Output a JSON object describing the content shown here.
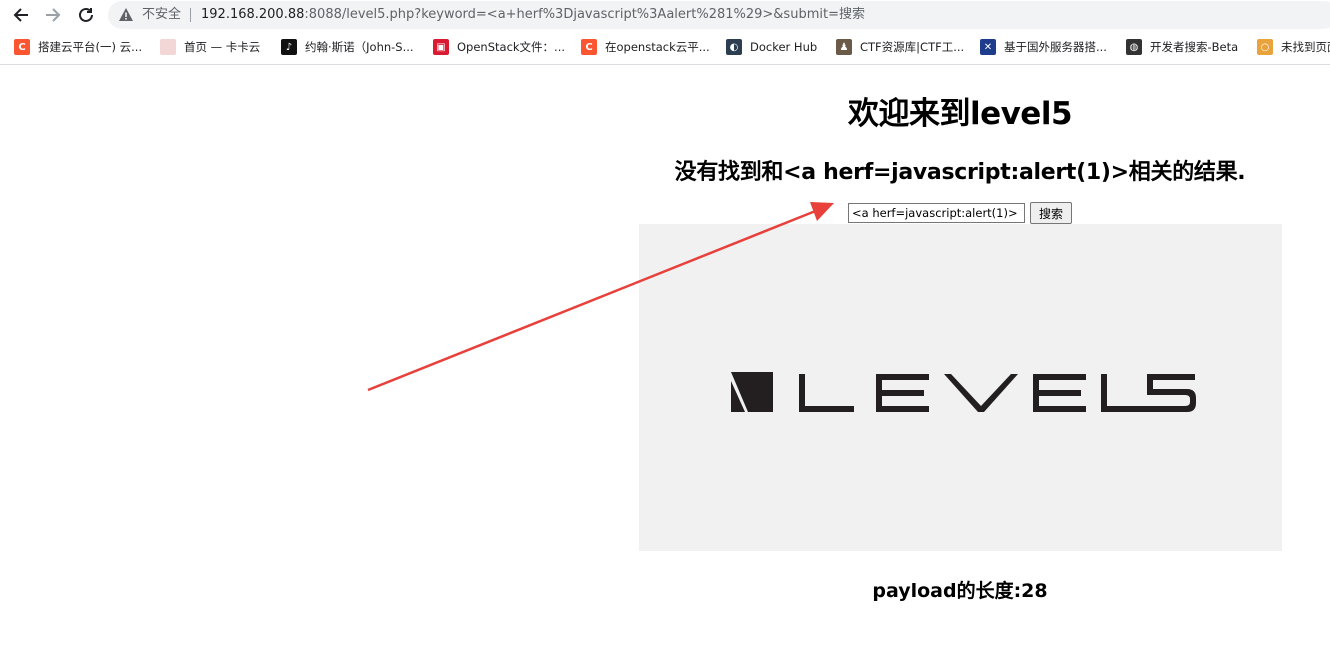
{
  "browser": {
    "security_label": "不安全",
    "url_host": "192.168.200.88",
    "url_rest": ":8088/level5.php?keyword=<a+herf%3Djavascript%3Aalert%281%29>&submit=搜索",
    "bookmarks": [
      {
        "label": "搭建云平台(一) 云...",
        "icon": "csdn-icon",
        "color": "#fc5531",
        "glyph": "C"
      },
      {
        "label": "首页 — 卡卡云",
        "icon": "kakayun-icon",
        "color": "#f3d6d6",
        "glyph": ""
      },
      {
        "label": "约翰·斯诺（John-S...",
        "icon": "tiktok-icon",
        "color": "#111111",
        "glyph": "♪"
      },
      {
        "label": "OpenStack文件：...",
        "icon": "openstack-icon",
        "color": "#da1a32",
        "glyph": "▣"
      },
      {
        "label": "在openstack云平...",
        "icon": "csdn-icon",
        "color": "#fc5531",
        "glyph": "C"
      },
      {
        "label": "Docker Hub",
        "icon": "docker-icon",
        "color": "#2c3e50",
        "glyph": "◐"
      },
      {
        "label": "CTF资源库|CTF工...",
        "icon": "hacker-icon",
        "color": "#6b5a48",
        "glyph": "♟"
      },
      {
        "label": "基于国外服务器搭...",
        "icon": "flag-icon",
        "color": "#1d3c8c",
        "glyph": "✕"
      },
      {
        "label": "开发者搜索-Beta",
        "icon": "globe-icon",
        "color": "#333333",
        "glyph": "◍"
      },
      {
        "label": "未找到页面",
        "icon": "loading-icon",
        "color": "#e8a33c",
        "glyph": "○"
      }
    ]
  },
  "page": {
    "title": "欢迎来到level5",
    "result_text": "没有找到和<a herf=javascript:alert(1)>相关的结果.",
    "search_value": "<a herf=javascript:alert(1)>",
    "search_button": "搜索",
    "banner_logo_text": "LEVEL5",
    "payload_text": "payload的长度:28"
  },
  "colors": {
    "arrow": "#e8413c",
    "banner_bg": "#f1f1f1",
    "logo": "#231f20"
  }
}
